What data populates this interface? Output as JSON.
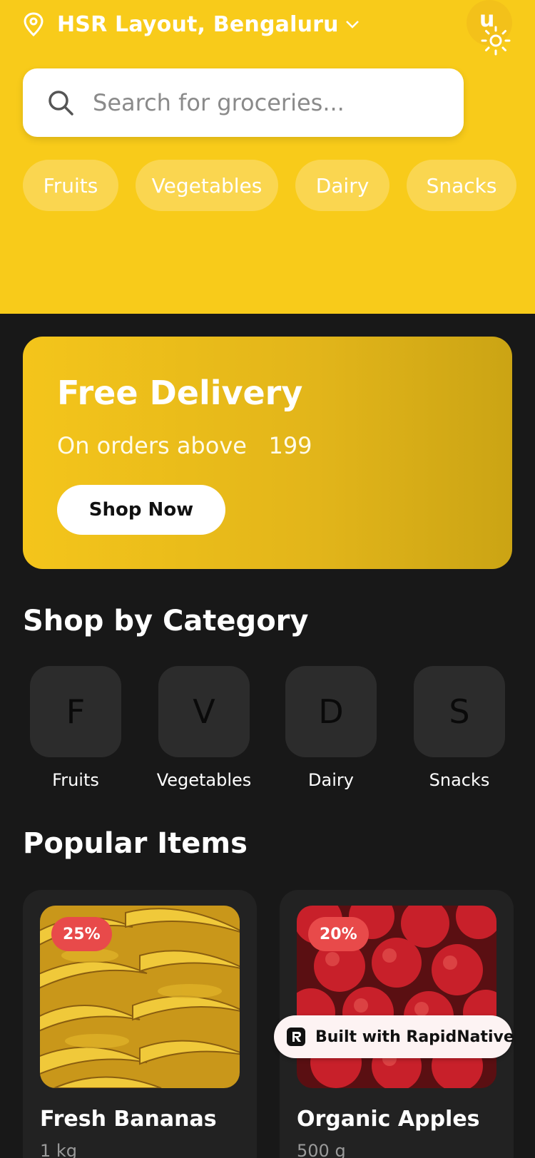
{
  "header": {
    "location": "HSR Layout, Bengaluru",
    "avatar_letter": "u",
    "search_placeholder": "Search for groceries...",
    "chips": [
      "Fruits",
      "Vegetables",
      "Dairy",
      "Snacks"
    ],
    "accent_color": "#f8cb1a"
  },
  "promo": {
    "title": "Free Delivery",
    "subtitle": "On orders above   199",
    "button_label": "Shop Now"
  },
  "categories": {
    "title": "Shop by Category",
    "items": [
      {
        "letter": "F",
        "label": "Fruits"
      },
      {
        "letter": "V",
        "label": "Vegetables"
      },
      {
        "letter": "D",
        "label": "Dairy"
      },
      {
        "letter": "S",
        "label": "Snacks"
      }
    ]
  },
  "popular": {
    "title": "Popular Items",
    "items": [
      {
        "name": "Fresh Bananas",
        "qty": "1 kg",
        "discount": "25%",
        "image": "bananas"
      },
      {
        "name": "Organic Apples",
        "qty": "500 g",
        "discount": "20%",
        "image": "apples"
      }
    ]
  },
  "built_badge": {
    "label": "Built with RapidNative"
  },
  "colors": {
    "background": "#181818",
    "card": "#222222",
    "badge_red": "#e84a4a"
  }
}
